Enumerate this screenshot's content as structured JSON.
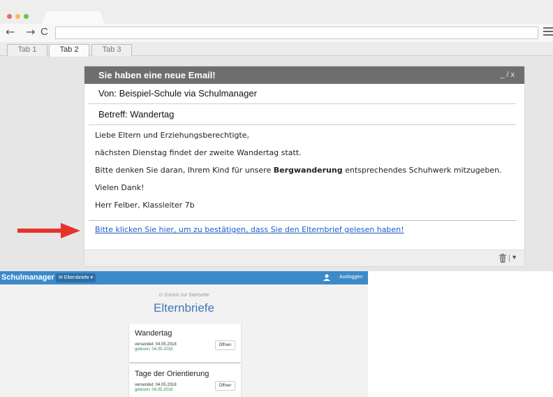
{
  "browser": {
    "tabs": [
      "Tab 1",
      "Tab 2",
      "Tab 3"
    ],
    "active_tab": "Tab 2",
    "back_label": "←",
    "forward_label": "→",
    "reload_label": "C"
  },
  "email": {
    "title": "Sie haben eine neue Email!",
    "window_controls": "_ / x",
    "from": "Von: Beispiel-Schule via Schulmanager",
    "subject": "Betreff: Wandertag",
    "body": {
      "greeting": "Liebe Eltern und Erziehungsberechtigte,",
      "line1": "nächsten Dienstag findet der zweite Wandertag statt.",
      "line2_before": "Bitte denken Sie daran, Ihrem Kind für unsere ",
      "line2_bold": "Bergwanderung",
      "line2_after": " entsprechendes Schuhwerk mitzugeben.",
      "thanks": "Vielen Dank!",
      "signature": "Herr Felber, Klassleiter 7b"
    },
    "confirm_link": "Bitte klicken Sie hier, um zu bestätigen, dass Sie den Elternbrief gelesen haben!",
    "footer_caret": "▼"
  },
  "arrow_color": "#e8322b",
  "schulmanager": {
    "brand": "Schulmanager",
    "menu_label": "✉ Elternbriefe ▾",
    "logout": "Ausloggen",
    "back_link": "⊙ Zurück zur Startseite",
    "page_title": "Elternbriefe",
    "letters": [
      {
        "title": "Wandertag",
        "sent": "versendet: 04.05.2018",
        "read": "gelesen: 04.05.2018",
        "button": "Öffnen"
      },
      {
        "title": "Tage der Orientierung",
        "sent": "versendet: 04.05.2018",
        "read": "gelesen: 04.05.2018",
        "button": "Öffnen"
      }
    ]
  },
  "colors": {
    "header_gray": "#6e6e6e",
    "link_blue": "#1b5ec7",
    "sm_blue": "#3d8ac9",
    "read_green": "#2e8b57"
  }
}
